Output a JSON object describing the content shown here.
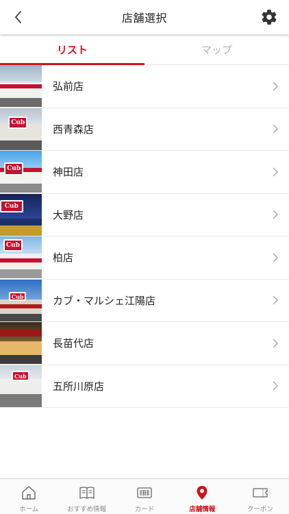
{
  "header": {
    "title": "店舗選択",
    "back_icon": "chevron-left-icon",
    "settings_icon": "gear-icon"
  },
  "tabs": [
    {
      "label": "リスト",
      "active": true
    },
    {
      "label": "マップ",
      "active": false
    }
  ],
  "stores": [
    {
      "name": "弘前店",
      "photo": "storefront-photo"
    },
    {
      "name": "西青森店",
      "photo": "storefront-photo"
    },
    {
      "name": "神田店",
      "photo": "storefront-photo"
    },
    {
      "name": "大野店",
      "photo": "storefront-photo"
    },
    {
      "name": "柏店",
      "photo": "storefront-photo"
    },
    {
      "name": "カブ・マルシェ江陽店",
      "photo": "storefront-photo"
    },
    {
      "name": "長苗代店",
      "photo": "storefront-photo"
    },
    {
      "name": "五所川原店",
      "photo": "storefront-photo"
    }
  ],
  "bottom_nav": [
    {
      "label": "ホーム",
      "icon": "home-icon",
      "active": false
    },
    {
      "label": "おすすめ情報",
      "icon": "book-icon",
      "active": false
    },
    {
      "label": "カード",
      "icon": "barcode-card-icon",
      "active": false
    },
    {
      "label": "店舗情報",
      "icon": "map-pin-icon",
      "active": true
    },
    {
      "label": "クーポン",
      "icon": "coupon-icon",
      "active": false
    }
  ],
  "colors": {
    "accent": "#d0121b",
    "inactive_text": "#b5b5b5",
    "divider": "#e8e8e8"
  }
}
